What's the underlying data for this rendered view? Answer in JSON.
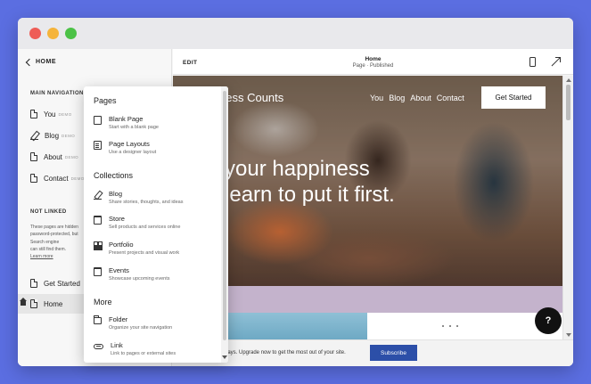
{
  "sidebar": {
    "back_label": "HOME",
    "main_nav_label": "MAIN NAVIGATION",
    "main_nav_items": [
      {
        "label": "You",
        "badge": "DEMO"
      },
      {
        "label": "Blog",
        "badge": "DEMO"
      },
      {
        "label": "About",
        "badge": "DEMO"
      },
      {
        "label": "Contact",
        "badge": "DEMO"
      }
    ],
    "not_linked_label": "NOT LINKED",
    "not_linked_lines": [
      "These pages are hidden",
      "password-protected, but",
      "Search engine",
      "can still find them.",
      "Learn more"
    ],
    "not_linked_items": [
      {
        "label": "Get Started"
      },
      {
        "label": "Home"
      }
    ]
  },
  "editor": {
    "edit_label": "EDIT",
    "page_title": "Home",
    "page_status": "Page · Published"
  },
  "preview": {
    "brand": "ness Counts",
    "menu": [
      "You",
      "Blog",
      "About",
      "Contact"
    ],
    "cta": "Get Started",
    "headline_lines": [
      "d your happiness",
      "n learn to put it first."
    ],
    "learn_more": "me",
    "help": "?"
  },
  "trial": {
    "text": "days. Upgrade now to get the most out of your site.",
    "button": "Subscribe"
  },
  "popup": {
    "pages_label": "Pages",
    "pages": [
      {
        "title": "Blank Page",
        "desc": "Start with a blank page"
      },
      {
        "title": "Page Layouts",
        "desc": "Use a designer layout"
      }
    ],
    "collections_label": "Collections",
    "collections": [
      {
        "title": "Blog",
        "desc": "Share stories, thoughts, and ideas"
      },
      {
        "title": "Store",
        "desc": "Sell products and services online"
      },
      {
        "title": "Portfolio",
        "desc": "Present projects and visual work"
      },
      {
        "title": "Events",
        "desc": "Showcase upcoming events"
      }
    ],
    "more_label": "More",
    "more": [
      {
        "title": "Folder",
        "desc": "Organize your site navigation"
      },
      {
        "title": "Link",
        "desc": "Link to pages or external sites"
      }
    ]
  }
}
